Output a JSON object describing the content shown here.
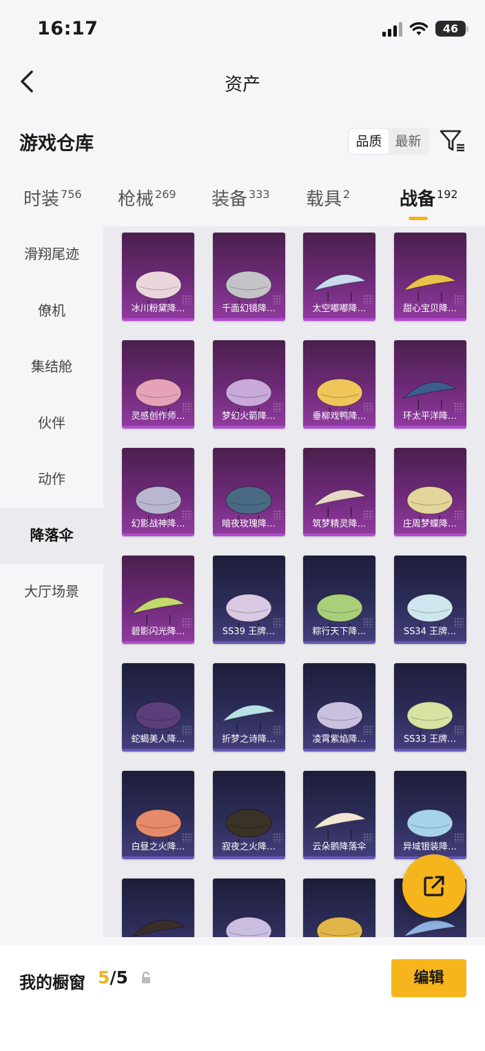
{
  "status": {
    "time": "16:17",
    "battery": "46"
  },
  "header": {
    "title": "资产"
  },
  "section": {
    "title": "游戏仓库"
  },
  "sort": {
    "options": [
      "品质",
      "最新"
    ],
    "selected": "品质"
  },
  "tabs": [
    {
      "label": "时装",
      "count": "756"
    },
    {
      "label": "枪械",
      "count": "269"
    },
    {
      "label": "装备",
      "count": "333"
    },
    {
      "label": "载具",
      "count": "2"
    },
    {
      "label": "战备",
      "count": "192",
      "active": true
    }
  ],
  "sidebar": {
    "items": [
      "滑翔尾迹",
      "僚机",
      "集结舱",
      "伙伴",
      "动作",
      "降落伞",
      "大厅场景"
    ],
    "selected": "降落伞"
  },
  "items": [
    {
      "label": "冰川粉黛降…",
      "tier": "purple",
      "color": "#ecd6de"
    },
    {
      "label": "千面幻镜降…",
      "tier": "purple",
      "color": "#c4c4c8"
    },
    {
      "label": "太空嘟嘟降…",
      "tier": "purple",
      "color": "#c9dcef"
    },
    {
      "label": "甜心宝贝降…",
      "tier": "purple",
      "color": "#e8c24a"
    },
    {
      "label": "灵感创作师…",
      "tier": "purple",
      "color": "#e6a3b8"
    },
    {
      "label": "梦幻火箭降…",
      "tier": "purple",
      "color": "#c9a9d9"
    },
    {
      "label": "垂柳戏鸭降…",
      "tier": "purple",
      "color": "#f0c65a"
    },
    {
      "label": "环太平洋降…",
      "tier": "purple",
      "color": "#3d5d8c"
    },
    {
      "label": "幻影战神降…",
      "tier": "purple",
      "color": "#b9b7cf"
    },
    {
      "label": "暗夜玫瑰降…",
      "tier": "purple",
      "color": "#4a6a84"
    },
    {
      "label": "筑梦精灵降…",
      "tier": "purple",
      "color": "#e9d7c6"
    },
    {
      "label": "庄周梦蝶降…",
      "tier": "purple",
      "color": "#e4d59a"
    },
    {
      "label": "碧影闪光降…",
      "tier": "purple",
      "color": "#c4d86b"
    },
    {
      "label": "SS39 王牌…",
      "tier": "blue",
      "color": "#d9c9e2"
    },
    {
      "label": "粽行天下降…",
      "tier": "blue",
      "color": "#a9cf7a"
    },
    {
      "label": "SS34 王牌…",
      "tier": "blue",
      "color": "#cfe6ef"
    },
    {
      "label": "蛇蝎美人降…",
      "tier": "blue",
      "color": "#5a3f7a"
    },
    {
      "label": "折梦之诗降…",
      "tier": "blue",
      "color": "#b8e1e6"
    },
    {
      "label": "凌霄紫焰降…",
      "tier": "blue",
      "color": "#c9c0e0"
    },
    {
      "label": "SS33 王牌…",
      "tier": "blue",
      "color": "#d6e3a2"
    },
    {
      "label": "白昼之火降…",
      "tier": "blue",
      "color": "#e58a6a"
    },
    {
      "label": "寂夜之火降…",
      "tier": "blue",
      "color": "#3a3226"
    },
    {
      "label": "云朵鹅降落伞",
      "tier": "blue",
      "color": "#f2e7d4"
    },
    {
      "label": "异域银装降…",
      "tier": "blue",
      "color": "#a6d3ea"
    },
    {
      "label": "",
      "tier": "blue",
      "color": "#3b2f2a"
    },
    {
      "label": "",
      "tier": "blue",
      "color": "#cbbde0"
    },
    {
      "label": "",
      "tier": "blue",
      "color": "#e0b54a"
    },
    {
      "label": "",
      "tier": "blue",
      "color": "#8fb2e0"
    }
  ],
  "showcase": {
    "label": "我的橱窗",
    "current": "5",
    "total": "/5"
  },
  "edit_button": {
    "label": "编辑"
  }
}
